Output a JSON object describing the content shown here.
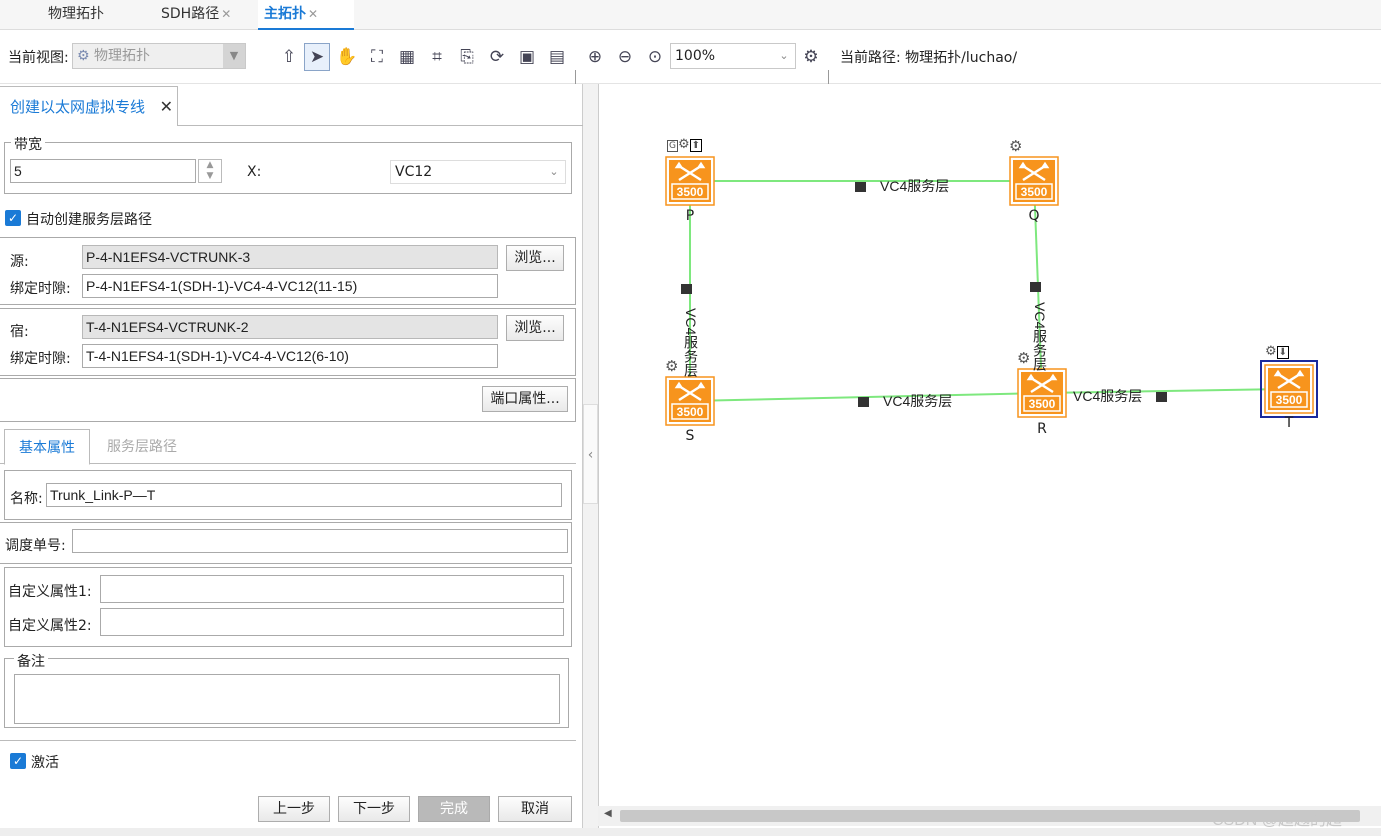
{
  "tabs": [
    {
      "label": "物理拓扑",
      "active": false,
      "closable": false
    },
    {
      "label": "SDH路径",
      "active": false,
      "closable": true
    },
    {
      "label": "主拓扑",
      "active": true,
      "closable": true
    }
  ],
  "toolbar": {
    "current_view_label": "当前视图:",
    "current_view_value": "物理拓扑",
    "zoom_value": "100%",
    "path_label": "当前路径: 物理拓扑/luchao/",
    "icons": [
      "up-arrow-icon",
      "pointer-icon",
      "hand-icon",
      "binoculars-icon",
      "table-icon",
      "fit-icon",
      "export-icon",
      "refresh-icon",
      "save-icon",
      "layout-icon",
      "zoom-in-icon",
      "zoom-out-icon",
      "zoom-fit-icon",
      "settings-icon"
    ]
  },
  "panel": {
    "tab_title": "创建以太网虚拟专线",
    "bandwidth": {
      "legend": "带宽",
      "value": "5",
      "x_label": "X:",
      "unit_value": "VC12"
    },
    "auto_create_label": "自动创建服务层路径",
    "source": {
      "label": "源:",
      "value": "P-4-N1EFS4-VCTRUNK-3",
      "timeslot_label": "绑定时隙:",
      "timeslot_value": "P-4-N1EFS4-1(SDH-1)-VC4-4-VC12(11-15)",
      "browse_label": "浏览..."
    },
    "sink": {
      "label": "宿:",
      "value": "T-4-N1EFS4-VCTRUNK-2",
      "timeslot_label": "绑定时隙:",
      "timeslot_value": "T-4-N1EFS4-1(SDH-1)-VC4-4-VC12(6-10)",
      "browse_label": "浏览..."
    },
    "port_props_label": "端口属性...",
    "subtabs": [
      {
        "label": "基本属性",
        "active": true
      },
      {
        "label": "服务层路径",
        "active": false
      }
    ],
    "name_label": "名称:",
    "name_value": "Trunk_Link-P—T",
    "dispatch_label": "调度单号:",
    "dispatch_value": "",
    "custom1_label": "自定义属性1:",
    "custom1_value": "",
    "custom2_label": "自定义属性2:",
    "custom2_value": "",
    "remark_legend": "备注",
    "remark_value": "",
    "activate_label": "激活",
    "buttons": {
      "prev": "上一步",
      "next": "下一步",
      "finish": "完成",
      "cancel": "取消"
    }
  },
  "topology": {
    "nodes": [
      {
        "id": "P",
        "label": "P",
        "model": "3500"
      },
      {
        "id": "Q",
        "label": "Q",
        "model": "3500"
      },
      {
        "id": "R",
        "label": "R",
        "model": "3500"
      },
      {
        "id": "S",
        "label": "S",
        "model": "3500"
      },
      {
        "id": "T",
        "label": "T",
        "model": "3500",
        "selected": true
      }
    ],
    "links": [
      {
        "from": "P",
        "to": "Q",
        "label": "VC4服务层"
      },
      {
        "from": "P",
        "to": "S",
        "label": "VC4服务层"
      },
      {
        "from": "Q",
        "to": "R",
        "label": "VC4服务层"
      },
      {
        "from": "S",
        "to": "R",
        "label": "VC4服务层"
      },
      {
        "from": "R",
        "to": "T",
        "label": "VC4服务层"
      }
    ],
    "link_color": "#7ee87e",
    "node_color": "#f7941d"
  },
  "watermark": "CSDN @超越的超"
}
